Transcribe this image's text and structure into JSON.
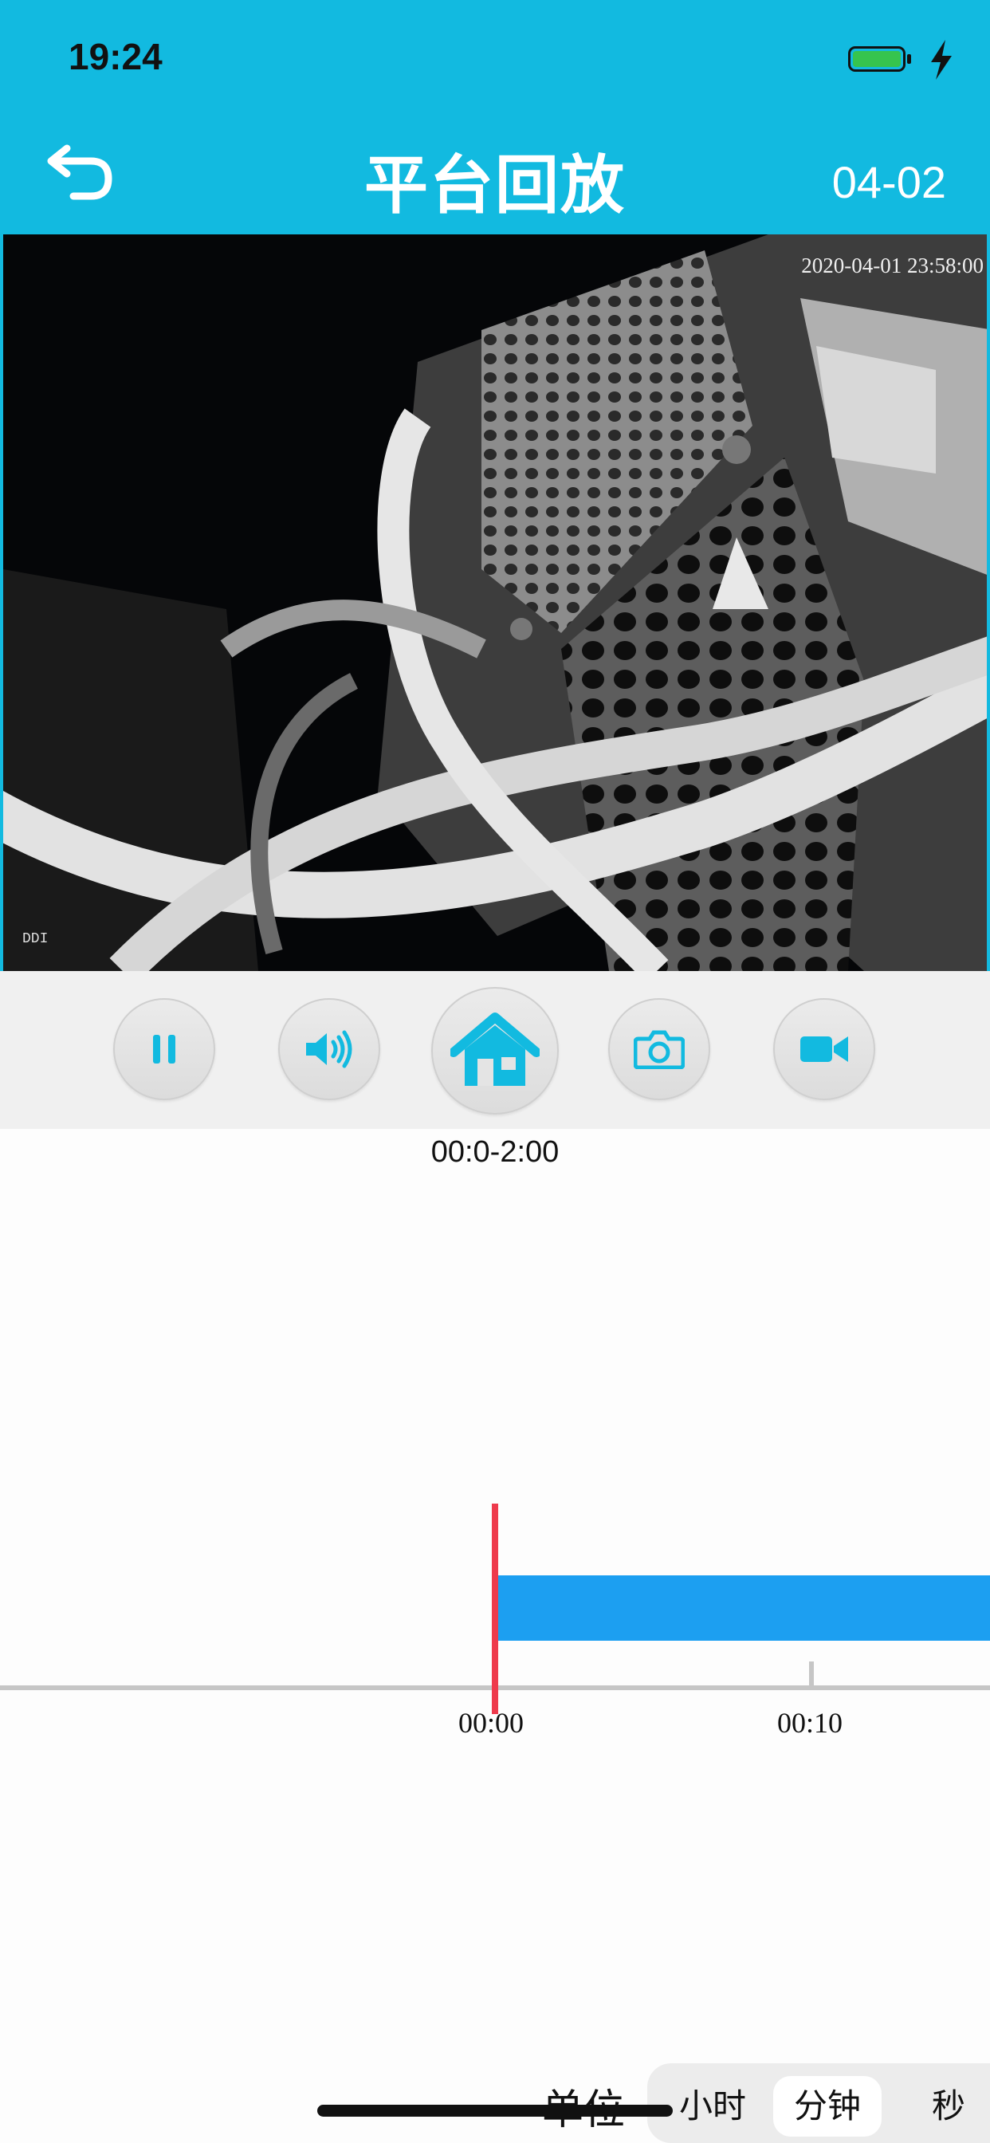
{
  "status_bar": {
    "time": "19:24"
  },
  "header": {
    "title": "平台回放",
    "date": "04-02"
  },
  "video": {
    "timestamp": "2020-04-01 23:58:00",
    "osd_mark": "DDI"
  },
  "controls": [
    {
      "name": "pause",
      "icon": "pause-icon"
    },
    {
      "name": "volume",
      "icon": "speaker-icon"
    },
    {
      "name": "home",
      "icon": "home-icon"
    },
    {
      "name": "snapshot",
      "icon": "camera-icon"
    },
    {
      "name": "record",
      "icon": "video-camera-icon"
    }
  ],
  "timeline": {
    "range_label": "00:0-2:00",
    "ticks": [
      "00:00",
      "00:10"
    ],
    "cursor_time": "00:00",
    "colors": {
      "recording": "#1c9ff1",
      "cursor": "#ee3a4c",
      "axis": "#c6c6c6"
    }
  },
  "units": {
    "label": "单位",
    "options": [
      "小时",
      "分钟",
      "秒"
    ],
    "selected": "分钟"
  },
  "theme": {
    "accent": "#12bae0",
    "icon_color": "#12bae0"
  }
}
